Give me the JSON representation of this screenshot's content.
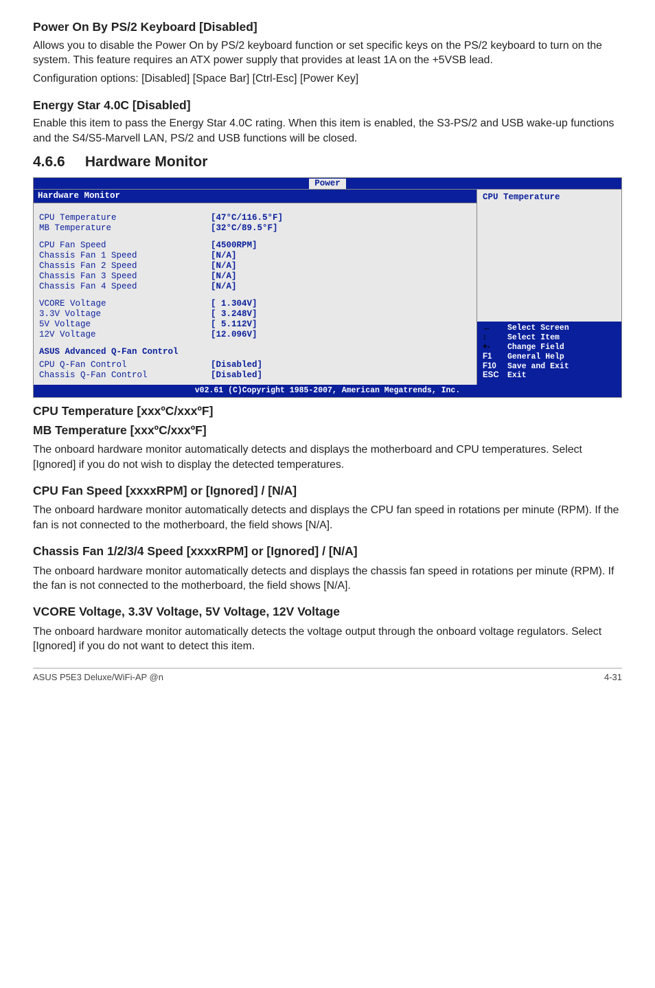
{
  "section1": {
    "title": "Power On By PS/2 Keyboard [Disabled]",
    "p1": "Allows you to disable the Power On by PS/2 keyboard function or set specific keys on the PS/2 keyboard to turn on the system. This feature requires an ATX power supply that provides at least 1A on the +5VSB lead.",
    "p2": "Configuration options: [Disabled] [Space Bar] [Ctrl-Esc] [Power Key]"
  },
  "section2": {
    "title": "Energy Star 4.0C [Disabled]",
    "p1": "Enable this item to pass the Energy Star 4.0C rating. When this item is enabled, the S3-PS/2 and USB wake-up functions and the S4/S5-Marvell LAN, PS/2 and USB functions will be closed."
  },
  "section3": {
    "num": "4.6.6",
    "title": "Hardware Monitor"
  },
  "bios": {
    "tab": "Power",
    "panel_title": "Hardware Monitor",
    "help_title": "CPU Temperature",
    "rows_a": [
      {
        "label": "CPU Temperature",
        "value": "[47°C/116.5°F]"
      },
      {
        "label": "MB Temperature",
        "value": "[32°C/89.5°F]"
      }
    ],
    "rows_b": [
      {
        "label": "CPU Fan Speed",
        "value": "[4500RPM]"
      },
      {
        "label": "Chassis Fan 1 Speed",
        "value": "[N/A]"
      },
      {
        "label": "Chassis Fan 2 Speed",
        "value": "[N/A]"
      },
      {
        "label": "Chassis Fan 3 Speed",
        "value": "[N/A]"
      },
      {
        "label": "Chassis Fan 4 Speed",
        "value": "[N/A]"
      }
    ],
    "rows_c": [
      {
        "label": "VCORE Voltage",
        "value": "[ 1.304V]"
      },
      {
        "label": "3.3V  Voltage",
        "value": "[ 3.248V]"
      },
      {
        "label": "5V   Voltage",
        "value": "[ 5.112V]"
      },
      {
        "label": "12V  Voltage",
        "value": "[12.096V]"
      }
    ],
    "adv_label": "ASUS Advanced Q-Fan Control",
    "rows_d": [
      {
        "label": "CPU Q-Fan Control",
        "value": "[Disabled]"
      },
      {
        "label": "Chassis Q-Fan Control",
        "value": "[Disabled]"
      }
    ],
    "help": [
      {
        "key": "←→",
        "text": "Select Screen",
        "black": true
      },
      {
        "key": "↑↓",
        "text": "Select Item",
        "black": true
      },
      {
        "key": "+-",
        "text": "Change Field",
        "black": true
      },
      {
        "key": "F1",
        "text": "General Help",
        "black": false
      },
      {
        "key": "F10",
        "text": "Save and Exit",
        "black": false
      },
      {
        "key": "ESC",
        "text": "Exit",
        "black": false
      }
    ],
    "footer": "v02.61 (C)Copyright 1985-2007, American Megatrends, Inc."
  },
  "section4": {
    "title1": "CPU Temperature [xxxºC/xxxºF]",
    "title2": "MB Temperature [xxxºC/xxxºF]",
    "p1": "The onboard hardware monitor automatically detects and displays the motherboard and CPU temperatures. Select [Ignored] if you do not wish to display the detected temperatures."
  },
  "section5": {
    "title": "CPU Fan Speed [xxxxRPM] or [Ignored] / [N/A]",
    "p1": "The onboard hardware monitor automatically detects and displays the CPU fan speed in rotations per minute (RPM). If the fan is not connected to the motherboard, the field shows [N/A]."
  },
  "section6": {
    "title": "Chassis Fan 1/2/3/4 Speed [xxxxRPM] or [Ignored] / [N/A]",
    "p1": "The onboard hardware monitor automatically detects and displays the chassis fan speed in rotations per minute (RPM). If the fan is not connected to the motherboard, the field shows [N/A]."
  },
  "section7": {
    "title": "VCORE Voltage, 3.3V Voltage, 5V Voltage, 12V Voltage",
    "p1": "The onboard hardware monitor automatically detects the voltage output through the onboard voltage regulators. Select [Ignored] if you do not want to detect this item."
  },
  "footer": {
    "left": "ASUS P5E3 Deluxe/WiFi-AP @n",
    "right": "4-31"
  }
}
